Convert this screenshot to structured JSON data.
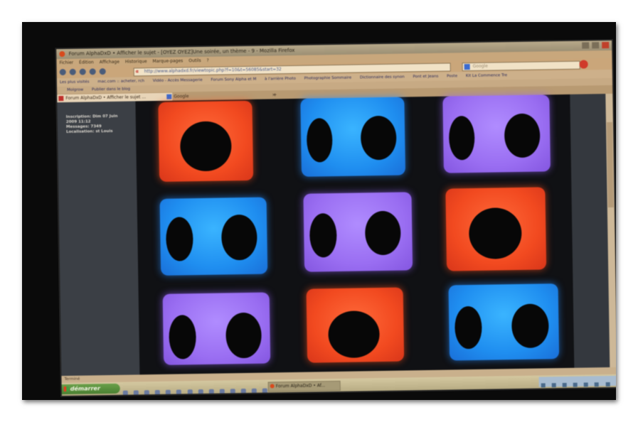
{
  "browser": {
    "window_title": "Forum AlphaDxD • Afficher le sujet - [OYEZ OYEZ]Une soirée, un thème - 9 - Mozilla Firefox",
    "menu": [
      "Fichier",
      "Édition",
      "Affichage",
      "Historique",
      "Marque-pages",
      "Outils",
      "?"
    ],
    "url": "http://www.alphadxd.fr/viewtopic.php?f=10&t=56085&start=32",
    "search_placeholder": "Google",
    "bookmarks_row1": [
      "Les plus visités",
      "mac.com :: acheter, rch",
      "Vidéo - Accès Messagerie",
      "Forum Sony Alpha et M",
      "à l'arrière Photo",
      "Photographie Sommaire",
      "Dictionnaire des synon",
      "Pont et Jeans",
      "Poste",
      "Kit La Commence Tre"
    ],
    "bookmarks_row2": [
      "Molgrow",
      "Publier dans le blog"
    ],
    "tabs": [
      {
        "label": "Forum AlphaDxD • Afficher le sujet ...",
        "close": "×"
      },
      {
        "label": "Google",
        "close": "×"
      }
    ],
    "new_tab": "+"
  },
  "profile": {
    "inscription": "Inscription: Dim 07 Juin",
    "inscription2": "2009 11:12",
    "messages": "Messages: 7349",
    "localisation": "Localisation: st Louis"
  },
  "status": "Terminé",
  "taskbar": {
    "start_label": "démarrer",
    "active_window": "Forum AlphaDxD • Af..."
  },
  "grid": [
    [
      "orange",
      "blue",
      "purple"
    ],
    [
      "blue",
      "purple",
      "orange"
    ],
    [
      "purple",
      "orange",
      "blue"
    ]
  ],
  "colors": {
    "orange_cube": "#f24a20",
    "blue_cube": "#1f8ef0",
    "purple_cube": "#9a6ef2"
  }
}
